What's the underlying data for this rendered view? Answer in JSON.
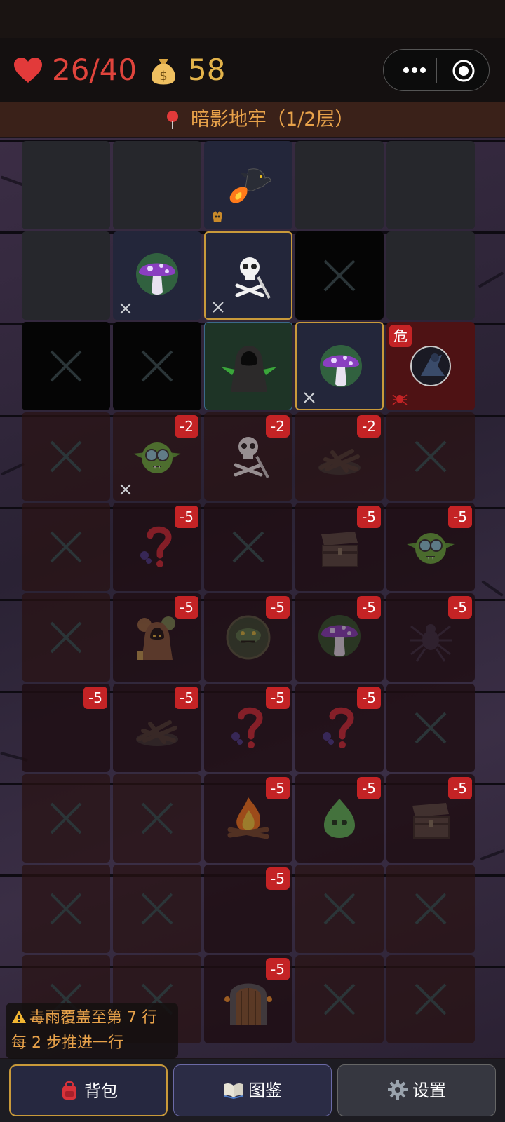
{
  "hud": {
    "hp": "26/40",
    "gold": "58",
    "icons": {
      "hp": "heart-icon",
      "gold": "money-bag-icon",
      "more": "more-dots-icon",
      "close": "target-close-icon"
    }
  },
  "location": {
    "text": "暗影地牢（1/2层）",
    "icon": "pin-icon"
  },
  "board": {
    "columns": 5,
    "rows": [
      [
        {
          "type": "dark"
        },
        {
          "type": "dark"
        },
        {
          "type": "blue",
          "icon": "fire-dragon-icon",
          "mini": "demon-mask-icon"
        },
        {
          "type": "dark"
        },
        {
          "type": "dark"
        }
      ],
      [
        {
          "type": "dark"
        },
        {
          "type": "blue",
          "icon": "poison-mushroom-icon",
          "swords": true
        },
        {
          "type": "blue",
          "sel": true,
          "icon": "skull-sword-icon",
          "swords": true
        },
        {
          "type": "black",
          "x": true
        },
        {
          "type": "dark"
        }
      ],
      [
        {
          "type": "black",
          "x": true
        },
        {
          "type": "black",
          "x": true
        },
        {
          "type": "green",
          "icon": "hooded-hero-icon"
        },
        {
          "type": "blue",
          "sel": true,
          "icon": "poison-mushroom-icon",
          "swords": true
        },
        {
          "type": "danger",
          "icon": "shadow-assassin-icon",
          "danger": "危",
          "mini": "spider-mini-icon"
        }
      ],
      [
        {
          "type": "fog",
          "x": true
        },
        {
          "type": "fog",
          "icon": "goblin-icon",
          "tag": "-2",
          "swords": true
        },
        {
          "type": "fog",
          "icon": "skull-sword-icon",
          "tag": "-2"
        },
        {
          "type": "fog",
          "icon": "burnt-campfire-icon",
          "tag": "-2"
        },
        {
          "type": "fog",
          "x": true
        }
      ],
      [
        {
          "type": "fog",
          "x": true
        },
        {
          "type": "fog2",
          "icon": "mystery-icon",
          "tag": "-5"
        },
        {
          "type": "fog2",
          "x": true
        },
        {
          "type": "fog2",
          "icon": "treasure-chest-icon",
          "tag": "-5"
        },
        {
          "type": "fog2",
          "icon": "goblin-icon",
          "tag": "-5"
        }
      ],
      [
        {
          "type": "fog",
          "x": true
        },
        {
          "type": "fog2",
          "icon": "merchant-icon",
          "tag": "-5"
        },
        {
          "type": "fog2",
          "icon": "serpent-shield-icon",
          "tag": "-5"
        },
        {
          "type": "fog2",
          "icon": "poison-mushroom-icon",
          "tag": "-5"
        },
        {
          "type": "fog2",
          "icon": "spider-icon",
          "tag": "-5"
        }
      ],
      [
        {
          "type": "fog2",
          "tag": "-5"
        },
        {
          "type": "fog2",
          "icon": "burnt-campfire-icon",
          "tag": "-5"
        },
        {
          "type": "fog2",
          "icon": "mystery-icon",
          "tag": "-5"
        },
        {
          "type": "fog2",
          "icon": "mystery-icon",
          "tag": "-5"
        },
        {
          "type": "fog2",
          "x": true
        }
      ],
      [
        {
          "type": "fog",
          "x": true
        },
        {
          "type": "fog",
          "x": true
        },
        {
          "type": "fog2",
          "icon": "campfire-icon",
          "tag": "-5"
        },
        {
          "type": "fog2",
          "icon": "slime-icon",
          "tag": "-5"
        },
        {
          "type": "fog2",
          "icon": "treasure-chest-icon",
          "tag": "-5"
        }
      ],
      [
        {
          "type": "fog",
          "x": true
        },
        {
          "type": "fog",
          "x": true
        },
        {
          "type": "fog2",
          "tag": "-5"
        },
        {
          "type": "fog",
          "x": true
        },
        {
          "type": "fog",
          "x": true
        }
      ],
      [
        {
          "type": "fog",
          "x": true
        },
        {
          "type": "fog",
          "x": true
        },
        {
          "type": "fog2",
          "icon": "dungeon-door-icon",
          "tag": "-5"
        },
        {
          "type": "fog",
          "x": true
        },
        {
          "type": "fog",
          "x": true
        }
      ]
    ]
  },
  "notice": {
    "line1": "毒雨覆盖至第 7 行",
    "line2": "每 2 步推进一行",
    "icon": "warning-icon"
  },
  "bottom": {
    "bag": "背包",
    "codex": "图鉴",
    "settings": "设置"
  },
  "colors": {
    "hp": "#e0443c",
    "gold": "#e3b34a",
    "accent": "#e8a24a",
    "badge": "#c42325",
    "selected_border": "#c99a3a"
  }
}
